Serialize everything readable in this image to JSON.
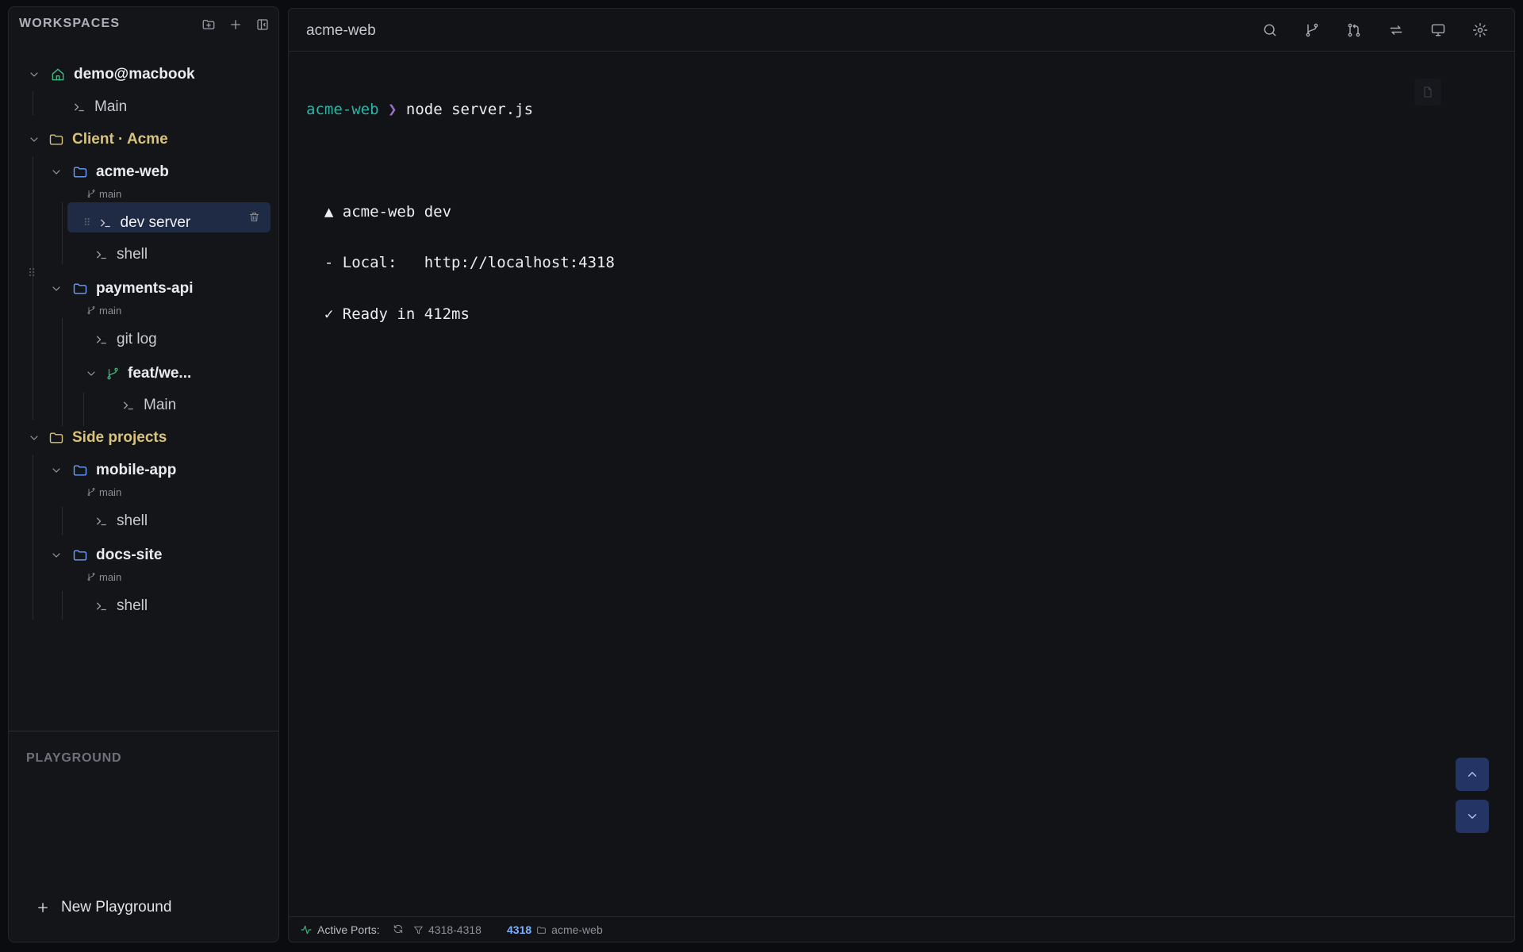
{
  "sidebar": {
    "title": "WORKSPACES",
    "tree": {
      "root": {
        "label": "demo@macbook",
        "children": [
          "Main"
        ]
      },
      "groups": [
        {
          "label": "Client · Acme",
          "repos": [
            {
              "name": "acme-web",
              "branch": "main",
              "sessions": [
                "dev server",
                "shell"
              ]
            },
            {
              "name": "payments-api",
              "branch": "main",
              "sessions": [
                "git log"
              ],
              "worktree": {
                "name": "feat/we...",
                "sessions": [
                  "Main"
                ]
              }
            }
          ]
        },
        {
          "label": "Side projects",
          "repos": [
            {
              "name": "mobile-app",
              "branch": "main",
              "sessions": [
                "shell"
              ]
            },
            {
              "name": "docs-site",
              "branch": "main",
              "sessions": [
                "shell"
              ]
            }
          ]
        }
      ]
    },
    "playground_title": "PLAYGROUND",
    "new_playground": "New Playground"
  },
  "main": {
    "title": "acme-web",
    "terminal": {
      "prompt_dir": "acme-web",
      "prompt_symbol": "❯",
      "command": "node server.js",
      "output": [
        "  ▲ acme-web dev",
        "  - Local:   http://localhost:4318",
        "  ✓ Ready in 412ms"
      ]
    }
  },
  "statusbar": {
    "label": "Active Ports:",
    "range": "4318-4318",
    "port": "4318",
    "port_workspace": "acme-web"
  },
  "colors": {
    "accent_green": "#3fb87f",
    "group_yellow": "#d9c27a",
    "folder_blue": "#6aa0ff",
    "prompt_teal": "#2fb3a6",
    "selected_bg": "#1f2a44"
  }
}
